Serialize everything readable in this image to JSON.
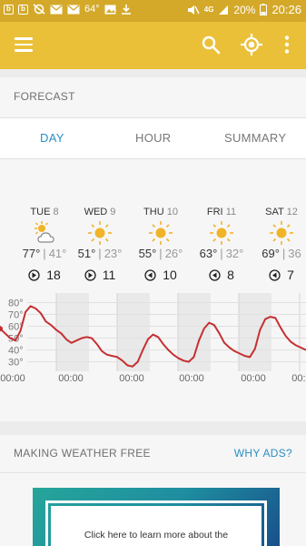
{
  "status_bar": {
    "temperature": "64°",
    "network": "4G",
    "battery": "20%",
    "time": "20:26"
  },
  "app_bar": {
    "menu_icon": "menu-icon",
    "search_icon": "search-icon",
    "location_icon": "my-location-icon",
    "more_icon": "more-vert-icon",
    "accent_color": "#ebc039"
  },
  "forecast": {
    "title": "FORECAST",
    "tabs": [
      {
        "label": "DAY",
        "active": true
      },
      {
        "label": "HOUR",
        "active": false
      },
      {
        "label": "SUMMARY",
        "active": false
      }
    ],
    "days": [
      {
        "name": "TUE",
        "num": "8",
        "icon": "partly-cloudy-icon",
        "hi": "77°",
        "lo": "41°",
        "wind": "18",
        "wind_dir": "wind-arrow-icon"
      },
      {
        "name": "WED",
        "num": "9",
        "icon": "sunny-icon",
        "hi": "51°",
        "lo": "23°",
        "wind": "11",
        "wind_dir": "wind-arrow-icon"
      },
      {
        "name": "THU",
        "num": "10",
        "icon": "sunny-icon",
        "hi": "55°",
        "lo": "26°",
        "wind": "10",
        "wind_dir": "wind-arrow-icon"
      },
      {
        "name": "FRI",
        "num": "11",
        "icon": "sunny-icon",
        "hi": "63°",
        "lo": "32°",
        "wind": "8",
        "wind_dir": "wind-arrow-icon"
      },
      {
        "name": "SAT",
        "num": "12",
        "icon": "sunny-icon",
        "hi": "69°",
        "lo": "36",
        "wind": "7",
        "wind_dir": "wind-arrow-icon"
      }
    ]
  },
  "chart_data": {
    "type": "line",
    "yticks": [
      "80°",
      "70°",
      "60°",
      "50°",
      "40°",
      "30°"
    ],
    "ylim": [
      22,
      85
    ],
    "xticks": [
      "00:00",
      "00:00",
      "00:00",
      "00:00",
      "00:00",
      "00:00"
    ],
    "line_color": "#c62f32",
    "series": [
      {
        "x": [
          0,
          2,
          4,
          6,
          8,
          10,
          12,
          14,
          16,
          18,
          20,
          22,
          24,
          26,
          28,
          30,
          32,
          34,
          36,
          38,
          40,
          42,
          44,
          46,
          48,
          50,
          52,
          54,
          56,
          58,
          60,
          62,
          64,
          66,
          68,
          70,
          72,
          74,
          76,
          78,
          80,
          82,
          84,
          86,
          88,
          90,
          92,
          94,
          96,
          98,
          100,
          102,
          104,
          106,
          108,
          110,
          112,
          114,
          116,
          118,
          120
        ],
        "y": [
          58,
          54,
          50,
          48,
          56,
          72,
          77,
          75,
          71,
          64,
          61,
          57,
          54,
          49,
          46,
          48,
          50,
          51,
          50,
          45,
          39,
          36,
          35,
          34,
          31,
          27,
          26,
          30,
          40,
          49,
          53,
          51,
          45,
          40,
          36,
          33,
          31,
          30,
          34,
          48,
          58,
          63,
          61,
          54,
          46,
          42,
          39,
          37,
          35,
          34,
          41,
          57,
          66,
          68,
          67,
          59,
          52,
          47,
          44,
          42,
          40
        ]
      }
    ],
    "grid": true
  },
  "ads": {
    "title": "MAKING WEATHER FREE",
    "why_label": "WHY ADS?",
    "banner_text": "Click here to learn more about the"
  }
}
